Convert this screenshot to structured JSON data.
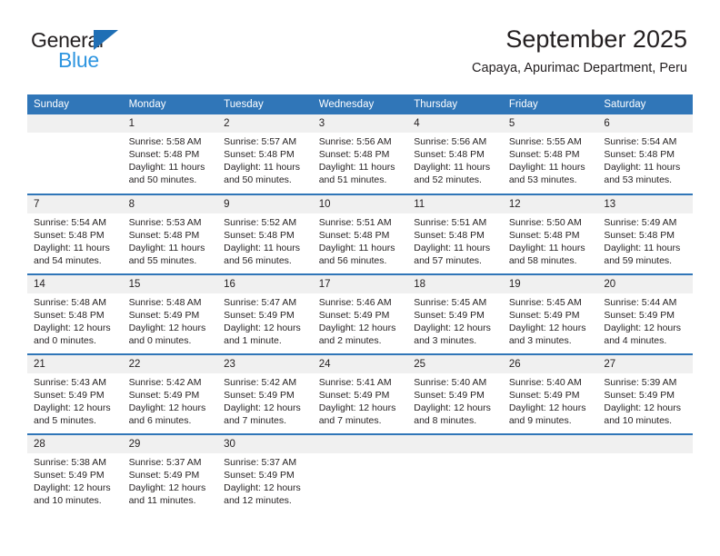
{
  "brand": {
    "name_top": "General",
    "name_bottom": "Blue",
    "triangle_color": "#1f6fb5",
    "blue_text_color": "#2e95e0"
  },
  "header": {
    "title": "September 2025",
    "subtitle": "Capaya, Apurimac Department, Peru"
  },
  "theme": {
    "header_bg": "#3076b8",
    "daynum_bg": "#f0f0f0",
    "text": "#231f20"
  },
  "weekdays": [
    "Sunday",
    "Monday",
    "Tuesday",
    "Wednesday",
    "Thursday",
    "Friday",
    "Saturday"
  ],
  "weeks": [
    [
      {
        "day": "",
        "lines": []
      },
      {
        "day": "1",
        "lines": [
          "Sunrise: 5:58 AM",
          "Sunset: 5:48 PM",
          "Daylight: 11 hours",
          "and 50 minutes."
        ]
      },
      {
        "day": "2",
        "lines": [
          "Sunrise: 5:57 AM",
          "Sunset: 5:48 PM",
          "Daylight: 11 hours",
          "and 50 minutes."
        ]
      },
      {
        "day": "3",
        "lines": [
          "Sunrise: 5:56 AM",
          "Sunset: 5:48 PM",
          "Daylight: 11 hours",
          "and 51 minutes."
        ]
      },
      {
        "day": "4",
        "lines": [
          "Sunrise: 5:56 AM",
          "Sunset: 5:48 PM",
          "Daylight: 11 hours",
          "and 52 minutes."
        ]
      },
      {
        "day": "5",
        "lines": [
          "Sunrise: 5:55 AM",
          "Sunset: 5:48 PM",
          "Daylight: 11 hours",
          "and 53 minutes."
        ]
      },
      {
        "day": "6",
        "lines": [
          "Sunrise: 5:54 AM",
          "Sunset: 5:48 PM",
          "Daylight: 11 hours",
          "and 53 minutes."
        ]
      }
    ],
    [
      {
        "day": "7",
        "lines": [
          "Sunrise: 5:54 AM",
          "Sunset: 5:48 PM",
          "Daylight: 11 hours",
          "and 54 minutes."
        ]
      },
      {
        "day": "8",
        "lines": [
          "Sunrise: 5:53 AM",
          "Sunset: 5:48 PM",
          "Daylight: 11 hours",
          "and 55 minutes."
        ]
      },
      {
        "day": "9",
        "lines": [
          "Sunrise: 5:52 AM",
          "Sunset: 5:48 PM",
          "Daylight: 11 hours",
          "and 56 minutes."
        ]
      },
      {
        "day": "10",
        "lines": [
          "Sunrise: 5:51 AM",
          "Sunset: 5:48 PM",
          "Daylight: 11 hours",
          "and 56 minutes."
        ]
      },
      {
        "day": "11",
        "lines": [
          "Sunrise: 5:51 AM",
          "Sunset: 5:48 PM",
          "Daylight: 11 hours",
          "and 57 minutes."
        ]
      },
      {
        "day": "12",
        "lines": [
          "Sunrise: 5:50 AM",
          "Sunset: 5:48 PM",
          "Daylight: 11 hours",
          "and 58 minutes."
        ]
      },
      {
        "day": "13",
        "lines": [
          "Sunrise: 5:49 AM",
          "Sunset: 5:48 PM",
          "Daylight: 11 hours",
          "and 59 minutes."
        ]
      }
    ],
    [
      {
        "day": "14",
        "lines": [
          "Sunrise: 5:48 AM",
          "Sunset: 5:48 PM",
          "Daylight: 12 hours",
          "and 0 minutes."
        ]
      },
      {
        "day": "15",
        "lines": [
          "Sunrise: 5:48 AM",
          "Sunset: 5:49 PM",
          "Daylight: 12 hours",
          "and 0 minutes."
        ]
      },
      {
        "day": "16",
        "lines": [
          "Sunrise: 5:47 AM",
          "Sunset: 5:49 PM",
          "Daylight: 12 hours",
          "and 1 minute."
        ]
      },
      {
        "day": "17",
        "lines": [
          "Sunrise: 5:46 AM",
          "Sunset: 5:49 PM",
          "Daylight: 12 hours",
          "and 2 minutes."
        ]
      },
      {
        "day": "18",
        "lines": [
          "Sunrise: 5:45 AM",
          "Sunset: 5:49 PM",
          "Daylight: 12 hours",
          "and 3 minutes."
        ]
      },
      {
        "day": "19",
        "lines": [
          "Sunrise: 5:45 AM",
          "Sunset: 5:49 PM",
          "Daylight: 12 hours",
          "and 3 minutes."
        ]
      },
      {
        "day": "20",
        "lines": [
          "Sunrise: 5:44 AM",
          "Sunset: 5:49 PM",
          "Daylight: 12 hours",
          "and 4 minutes."
        ]
      }
    ],
    [
      {
        "day": "21",
        "lines": [
          "Sunrise: 5:43 AM",
          "Sunset: 5:49 PM",
          "Daylight: 12 hours",
          "and 5 minutes."
        ]
      },
      {
        "day": "22",
        "lines": [
          "Sunrise: 5:42 AM",
          "Sunset: 5:49 PM",
          "Daylight: 12 hours",
          "and 6 minutes."
        ]
      },
      {
        "day": "23",
        "lines": [
          "Sunrise: 5:42 AM",
          "Sunset: 5:49 PM",
          "Daylight: 12 hours",
          "and 7 minutes."
        ]
      },
      {
        "day": "24",
        "lines": [
          "Sunrise: 5:41 AM",
          "Sunset: 5:49 PM",
          "Daylight: 12 hours",
          "and 7 minutes."
        ]
      },
      {
        "day": "25",
        "lines": [
          "Sunrise: 5:40 AM",
          "Sunset: 5:49 PM",
          "Daylight: 12 hours",
          "and 8 minutes."
        ]
      },
      {
        "day": "26",
        "lines": [
          "Sunrise: 5:40 AM",
          "Sunset: 5:49 PM",
          "Daylight: 12 hours",
          "and 9 minutes."
        ]
      },
      {
        "day": "27",
        "lines": [
          "Sunrise: 5:39 AM",
          "Sunset: 5:49 PM",
          "Daylight: 12 hours",
          "and 10 minutes."
        ]
      }
    ],
    [
      {
        "day": "28",
        "lines": [
          "Sunrise: 5:38 AM",
          "Sunset: 5:49 PM",
          "Daylight: 12 hours",
          "and 10 minutes."
        ]
      },
      {
        "day": "29",
        "lines": [
          "Sunrise: 5:37 AM",
          "Sunset: 5:49 PM",
          "Daylight: 12 hours",
          "and 11 minutes."
        ]
      },
      {
        "day": "30",
        "lines": [
          "Sunrise: 5:37 AM",
          "Sunset: 5:49 PM",
          "Daylight: 12 hours",
          "and 12 minutes."
        ]
      },
      {
        "day": "",
        "lines": []
      },
      {
        "day": "",
        "lines": []
      },
      {
        "day": "",
        "lines": []
      },
      {
        "day": "",
        "lines": []
      }
    ]
  ]
}
